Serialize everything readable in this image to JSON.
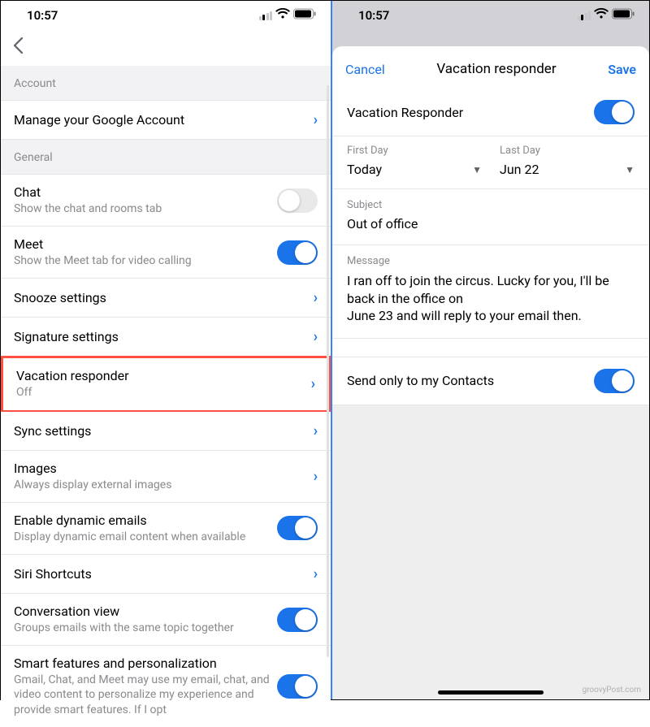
{
  "status": {
    "time": "10:57"
  },
  "left": {
    "sections": {
      "account": "Account",
      "general": "General"
    },
    "rows": {
      "manage": {
        "title": "Manage your Google Account"
      },
      "chat": {
        "title": "Chat",
        "sub": "Show the chat and rooms tab"
      },
      "meet": {
        "title": "Meet",
        "sub": "Show the Meet tab for video calling"
      },
      "snooze": {
        "title": "Snooze settings"
      },
      "signature": {
        "title": "Signature settings"
      },
      "vacation": {
        "title": "Vacation responder",
        "sub": "Off"
      },
      "sync": {
        "title": "Sync settings"
      },
      "images": {
        "title": "Images",
        "sub": "Always display external images"
      },
      "dynamic": {
        "title": "Enable dynamic emails",
        "sub": "Display dynamic email content when available"
      },
      "siri": {
        "title": "Siri Shortcuts"
      },
      "conversation": {
        "title": "Conversation view",
        "sub": "Groups emails with the same topic together"
      },
      "smart": {
        "title": "Smart features and personalization",
        "sub": "Gmail, Chat, and Meet may use my email, chat, and video content to personalize my experience and provide smart features. If I opt"
      }
    }
  },
  "right": {
    "header": {
      "cancel": "Cancel",
      "title": "Vacation responder",
      "save": "Save"
    },
    "responder_label": "Vacation Responder",
    "first_day": {
      "label": "First Day",
      "value": "Today"
    },
    "last_day": {
      "label": "Last Day",
      "value": "Jun 22"
    },
    "subject": {
      "label": "Subject",
      "value": "Out of office"
    },
    "message": {
      "label": "Message",
      "value": "I ran off to join the circus. Lucky for you, I'll be back in the office on\nJune 23 and will reply to your email then."
    },
    "contacts_only": "Send only to my Contacts"
  },
  "watermark": "groovyPost.com"
}
